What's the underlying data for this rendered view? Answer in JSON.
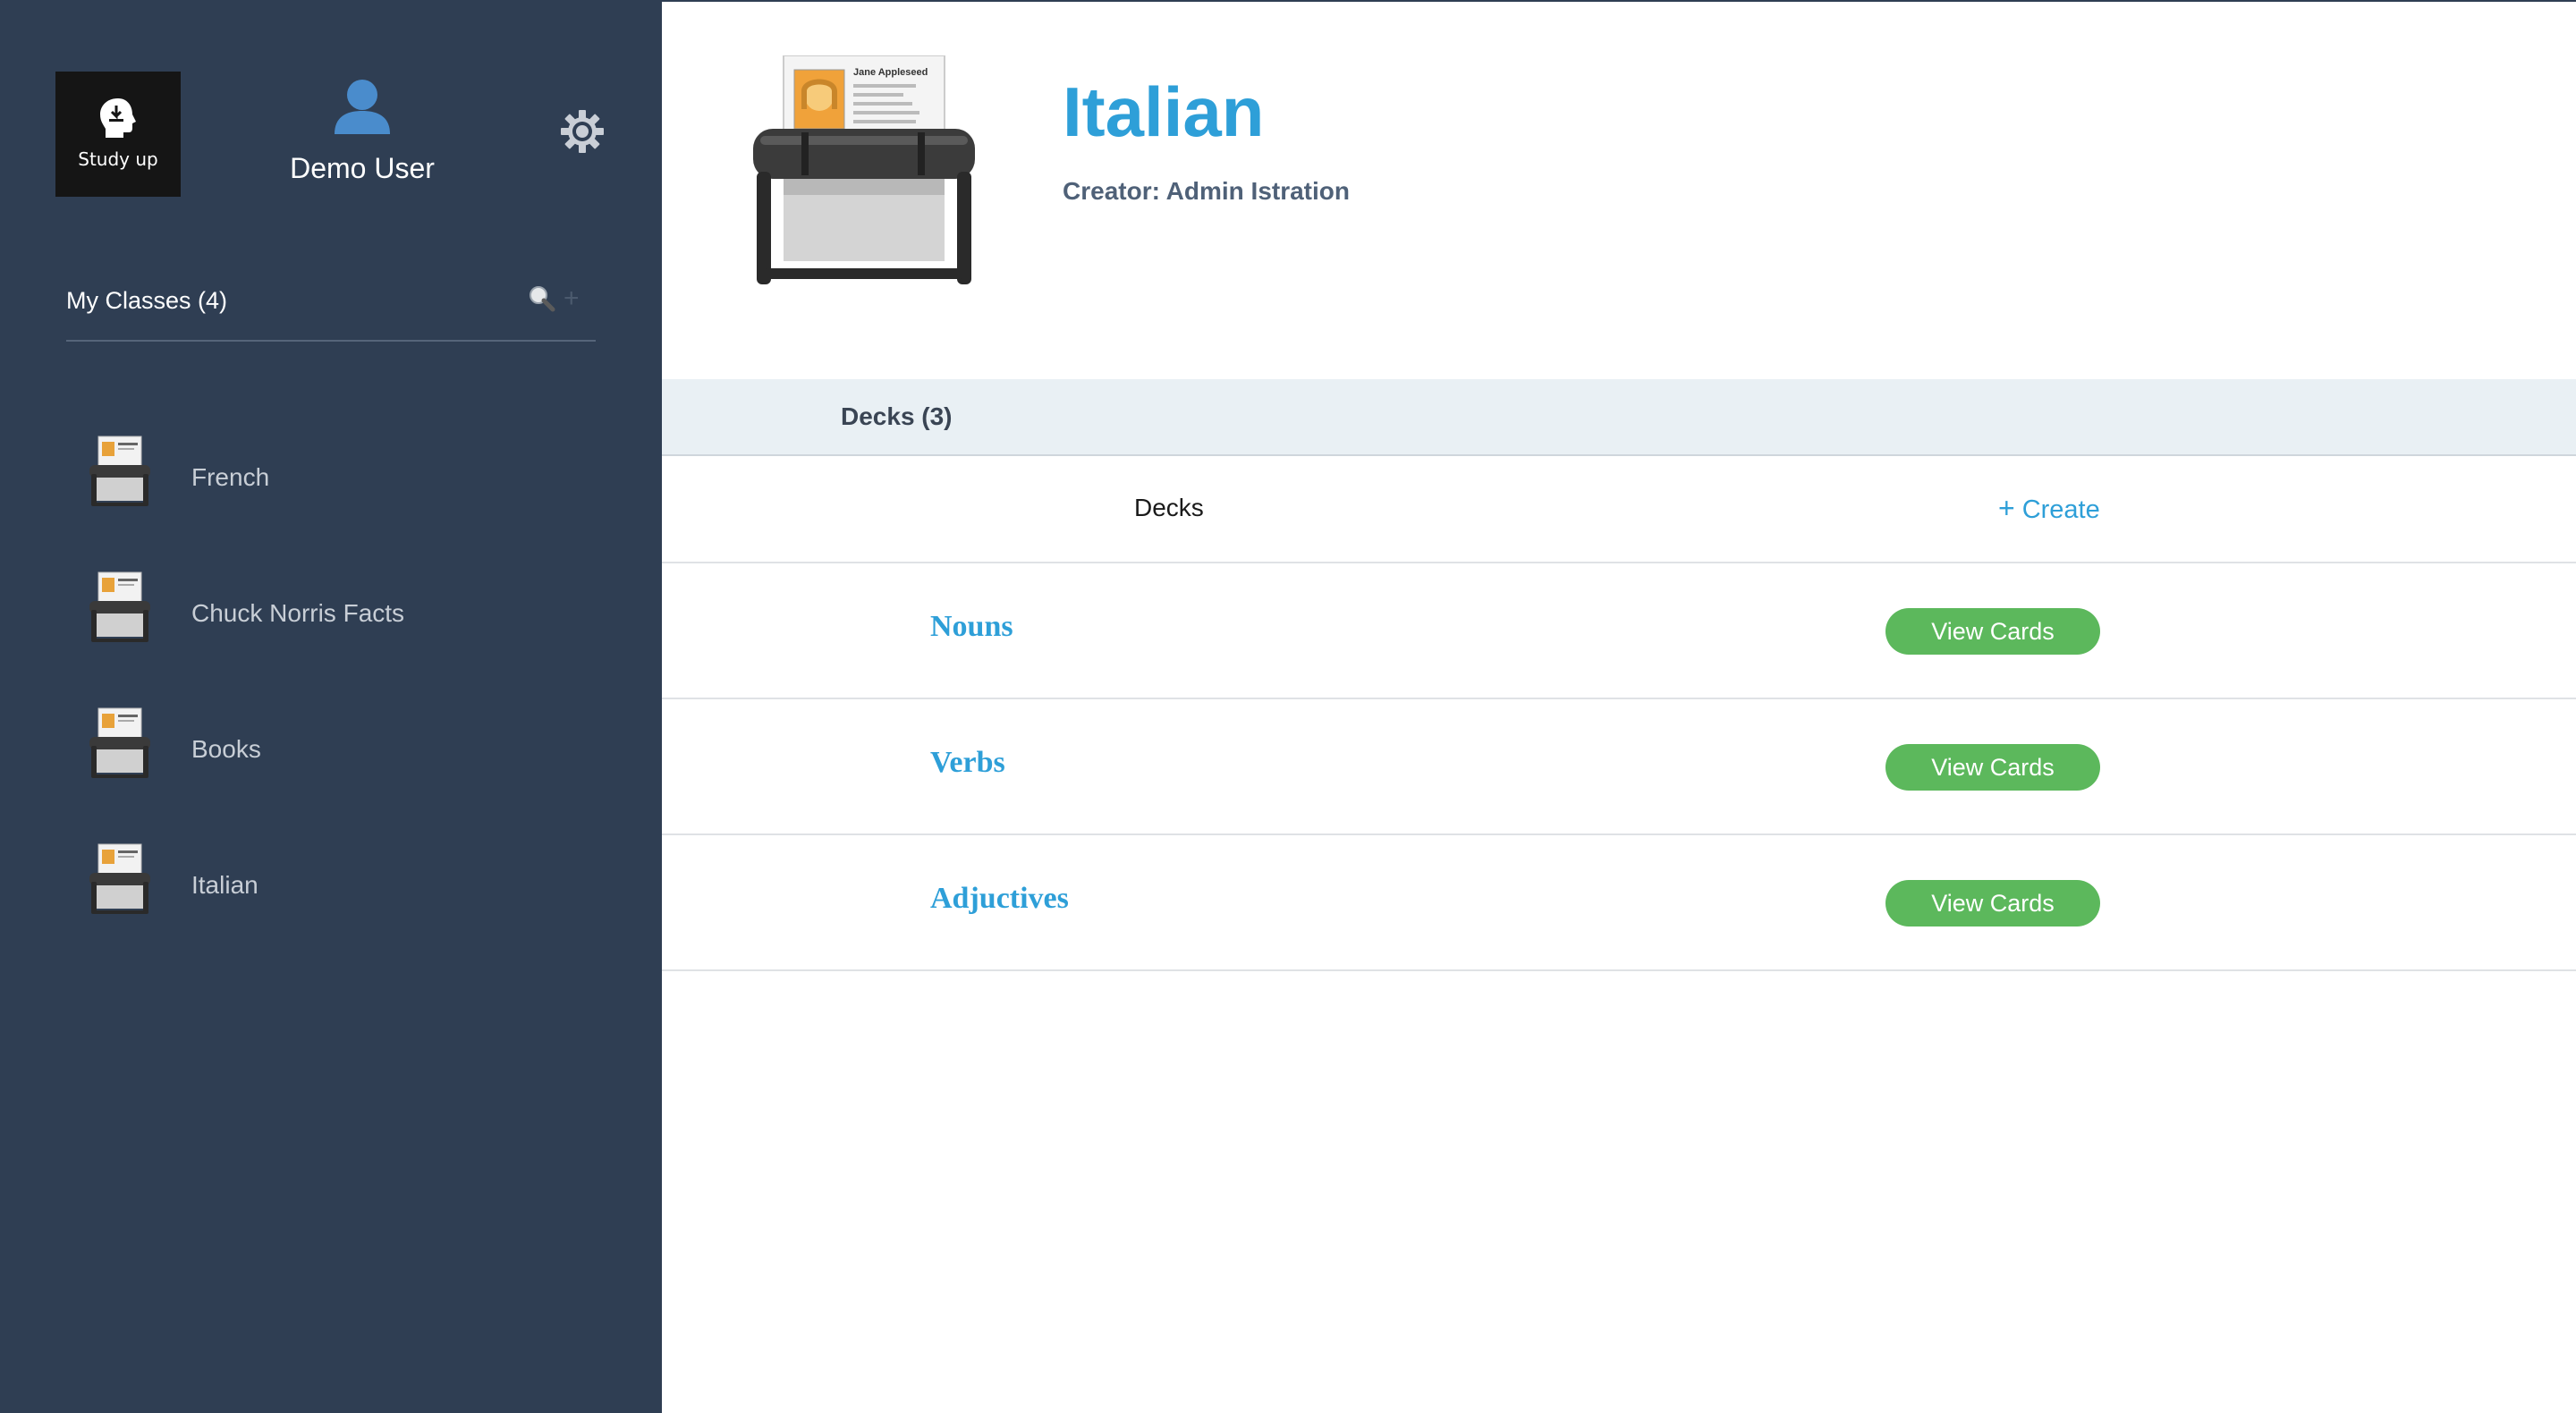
{
  "sidebar": {
    "logo_text": "Study up",
    "user_name": "Demo User",
    "classes_title": "My Classes (4)",
    "add_symbol": "+",
    "classes": [
      {
        "label": "French"
      },
      {
        "label": "Chuck Norris Facts"
      },
      {
        "label": "Books"
      },
      {
        "label": "Italian"
      }
    ]
  },
  "main": {
    "title": "Italian",
    "creator": "Creator: Admin Istration",
    "decks_tab": "Decks (3)",
    "column_decks": "Decks",
    "create_plus": "+",
    "create_label": "Create",
    "card_name_text": "Jane Appleseed",
    "decks": [
      {
        "name": "Nouns",
        "button": "View Cards"
      },
      {
        "name": "Verbs",
        "button": "View Cards"
      },
      {
        "name": "Adjuctives",
        "button": "View Cards"
      }
    ]
  },
  "colors": {
    "sidebar_bg": "#2f3e53",
    "accent_blue": "#2e9fd8",
    "button_green": "#5cb85c",
    "decks_bar_bg": "#e9f0f4"
  },
  "icons": [
    "study-up-logo-icon",
    "user-icon",
    "gear-icon",
    "search-icon",
    "plus-icon",
    "card-file-icon"
  ]
}
